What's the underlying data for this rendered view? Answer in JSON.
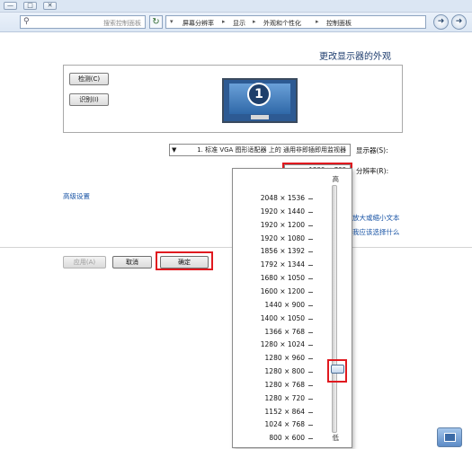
{
  "window": {
    "minimize": "—",
    "maximize": "□",
    "close": "✕"
  },
  "address": {
    "search_placeholder": "搜索控制面板",
    "refresh_glyph": "↻",
    "breadcrumbs": [
      "控制面板",
      "外观和个性化",
      "显示",
      "屏幕分辨率"
    ],
    "separator": "▸",
    "dropdown_glyph": "▾"
  },
  "page": {
    "title": "更改显示器的外观",
    "detect_button": "检测(C)",
    "identify_button": "识别(I)",
    "monitor_number": "1",
    "display_label": "显示器(S):",
    "display_value": "1. 标准 VGA 图形适配器 上的 通用非即插即用监视器",
    "resolution_label": "分辨率(R):",
    "resolution_value": "1280 × 768",
    "advanced_link": "高级设置",
    "text_size_link": "放大或缩小文本",
    "which_settings_link": "我应该选择什么"
  },
  "buttons": {
    "ok": "确定",
    "cancel": "取消",
    "apply": "应用(A)"
  },
  "resolution_dropdown": {
    "high_label": "高",
    "low_label": "低",
    "options": [
      "2048 × 1536",
      "1920 × 1440",
      "1920 × 1200",
      "1920 × 1080",
      "1856 × 1392",
      "1792 × 1344",
      "1680 × 1050",
      "1600 × 1200",
      "1440 × 900",
      "1400 × 1050",
      "1366 × 768",
      "1280 × 1024",
      "1280 × 960",
      "1280 × 800",
      "1280 × 768",
      "1280 × 720",
      "1152 × 864",
      "1024 × 768",
      "800 × 600"
    ],
    "selected_index": 14
  },
  "colors": {
    "highlight": "#e0191f",
    "link": "#1a55a6",
    "title": "#1d3c6e"
  }
}
